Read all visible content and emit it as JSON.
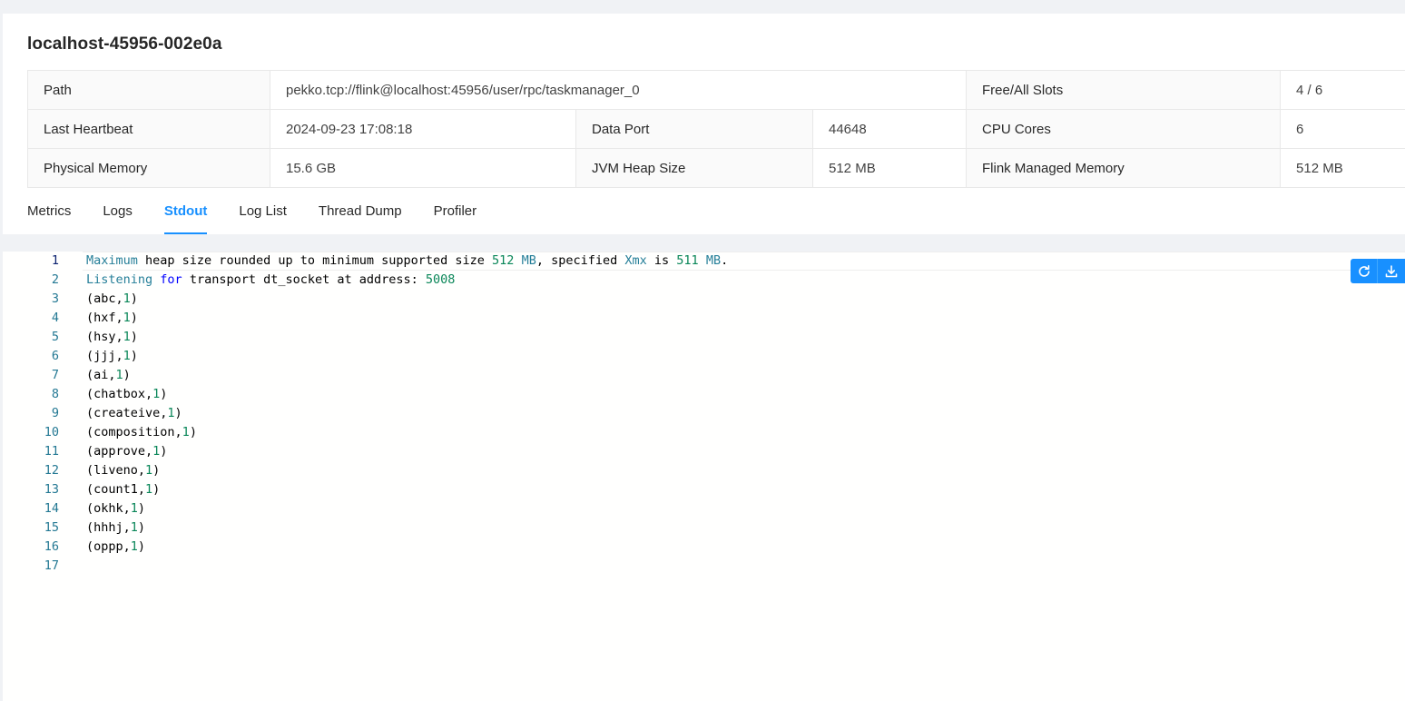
{
  "taskmanager": {
    "title": "localhost-45956-002e0a",
    "details": {
      "path_label": "Path",
      "path_value": "pekko.tcp://flink@localhost:45956/user/rpc/taskmanager_0",
      "slots_label": "Free/All Slots",
      "slots_value": "4 / 6",
      "heartbeat_label": "Last Heartbeat",
      "heartbeat_value": "2024-09-23 17:08:18",
      "data_port_label": "Data Port",
      "data_port_value": "44648",
      "cpu_label": "CPU Cores",
      "cpu_value": "6",
      "phys_mem_label": "Physical Memory",
      "phys_mem_value": "15.6 GB",
      "heap_label": "JVM Heap Size",
      "heap_value": "512 MB",
      "managed_label": "Flink Managed Memory",
      "managed_value": "512 MB"
    }
  },
  "tabs": [
    {
      "label": "Metrics",
      "active": false
    },
    {
      "label": "Logs",
      "active": false
    },
    {
      "label": "Stdout",
      "active": true
    },
    {
      "label": "Log List",
      "active": false
    },
    {
      "label": "Thread Dump",
      "active": false
    },
    {
      "label": "Profiler",
      "active": false
    }
  ],
  "editor": {
    "line_numbers": [
      "1",
      "2",
      "3",
      "4",
      "5",
      "6",
      "7",
      "8",
      "9",
      "10",
      "11",
      "12",
      "13",
      "14",
      "15",
      "16",
      "17"
    ],
    "active_line": 1,
    "lines": [
      [
        {
          "t": "Maximum",
          "c": "ident"
        },
        {
          "t": " heap size rounded up to minimum supported size "
        },
        {
          "t": "512",
          "c": "num"
        },
        {
          "t": " "
        },
        {
          "t": "MB",
          "c": "ident"
        },
        {
          "t": ", specified "
        },
        {
          "t": "Xmx",
          "c": "ident"
        },
        {
          "t": " is "
        },
        {
          "t": "511",
          "c": "num"
        },
        {
          "t": " "
        },
        {
          "t": "MB",
          "c": "ident"
        },
        {
          "t": "."
        }
      ],
      [
        {
          "t": "Listening",
          "c": "ident"
        },
        {
          "t": " "
        },
        {
          "t": "for",
          "c": "kw"
        },
        {
          "t": " transport dt_socket at address: "
        },
        {
          "t": "5008",
          "c": "num"
        }
      ],
      [
        {
          "t": "(abc,"
        },
        {
          "t": "1",
          "c": "num"
        },
        {
          "t": ")"
        }
      ],
      [
        {
          "t": "(hxf,"
        },
        {
          "t": "1",
          "c": "num"
        },
        {
          "t": ")"
        }
      ],
      [
        {
          "t": "(hsy,"
        },
        {
          "t": "1",
          "c": "num"
        },
        {
          "t": ")"
        }
      ],
      [
        {
          "t": "(jjj,"
        },
        {
          "t": "1",
          "c": "num"
        },
        {
          "t": ")"
        }
      ],
      [
        {
          "t": "(ai,"
        },
        {
          "t": "1",
          "c": "num"
        },
        {
          "t": ")"
        }
      ],
      [
        {
          "t": "(chatbox,"
        },
        {
          "t": "1",
          "c": "num"
        },
        {
          "t": ")"
        }
      ],
      [
        {
          "t": "(createive,"
        },
        {
          "t": "1",
          "c": "num"
        },
        {
          "t": ")"
        }
      ],
      [
        {
          "t": "(composition,"
        },
        {
          "t": "1",
          "c": "num"
        },
        {
          "t": ")"
        }
      ],
      [
        {
          "t": "(approve,"
        },
        {
          "t": "1",
          "c": "num"
        },
        {
          "t": ")"
        }
      ],
      [
        {
          "t": "(liveno,"
        },
        {
          "t": "1",
          "c": "num"
        },
        {
          "t": ")"
        }
      ],
      [
        {
          "t": "(count1,"
        },
        {
          "t": "1",
          "c": "num"
        },
        {
          "t": ")"
        }
      ],
      [
        {
          "t": "(okhk,"
        },
        {
          "t": "1",
          "c": "num"
        },
        {
          "t": ")"
        }
      ],
      [
        {
          "t": "(hhhj,"
        },
        {
          "t": "1",
          "c": "num"
        },
        {
          "t": ")"
        }
      ],
      [
        {
          "t": "(oppp,"
        },
        {
          "t": "1",
          "c": "num"
        },
        {
          "t": ")"
        }
      ],
      []
    ]
  },
  "actions": {
    "reload_icon": "reload-icon",
    "download_icon": "download-icon"
  },
  "colors": {
    "accent": "#1890ff",
    "line_number": "#237893",
    "identifier": "#267f99",
    "number": "#098658",
    "keyword": "#0000ff"
  }
}
